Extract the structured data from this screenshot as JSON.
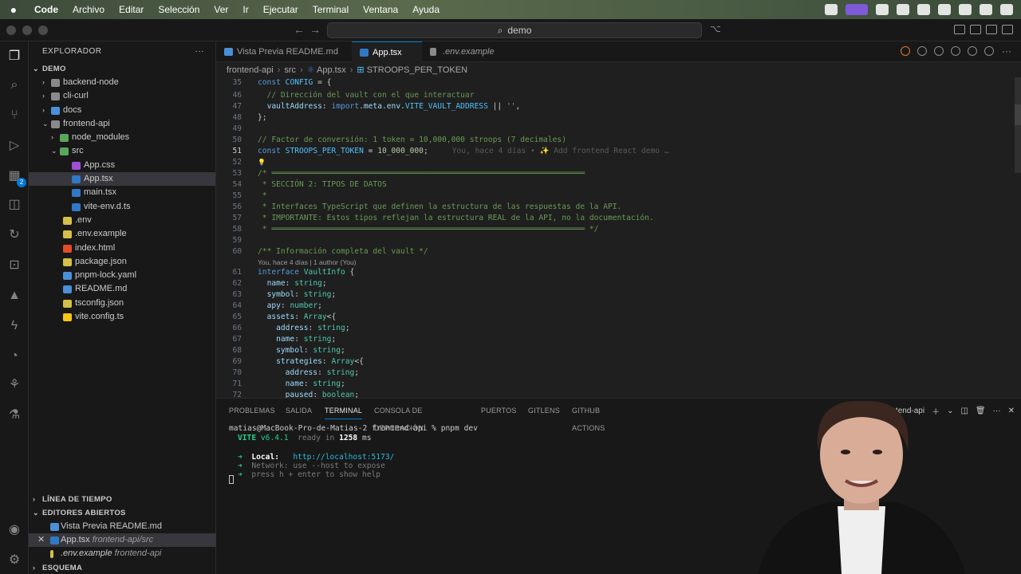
{
  "menubar": {
    "apple": "",
    "items": [
      "Code",
      "Archivo",
      "Editar",
      "Selección",
      "Ver",
      "Ir",
      "Ejecutar",
      "Terminal",
      "Ventana",
      "Ayuda"
    ]
  },
  "titlebar": {
    "search": "demo"
  },
  "explorer": {
    "title": "EXPLORADOR",
    "root": "DEMO",
    "tree": [
      {
        "label": "backend-node",
        "depth": 1,
        "kind": "folder",
        "chev": "›"
      },
      {
        "label": "cli-curl",
        "depth": 1,
        "kind": "folder",
        "chev": "›"
      },
      {
        "label": "docs",
        "depth": 1,
        "kind": "folder-blue",
        "chev": "›"
      },
      {
        "label": "frontend-api",
        "depth": 1,
        "kind": "folder",
        "chev": "⌄"
      },
      {
        "label": "node_modules",
        "depth": 2,
        "kind": "folder-green",
        "chev": "›"
      },
      {
        "label": "src",
        "depth": 2,
        "kind": "folder-green",
        "chev": "⌄"
      },
      {
        "label": "App.css",
        "depth": 3,
        "kind": "css"
      },
      {
        "label": "App.tsx",
        "depth": 3,
        "kind": "tsx",
        "selected": true
      },
      {
        "label": "main.tsx",
        "depth": 3,
        "kind": "tsx"
      },
      {
        "label": "vite-env.d.ts",
        "depth": 3,
        "kind": "ts"
      },
      {
        "label": ".env",
        "depth": 2,
        "kind": "env"
      },
      {
        "label": ".env.example",
        "depth": 2,
        "kind": "env"
      },
      {
        "label": "index.html",
        "depth": 2,
        "kind": "html"
      },
      {
        "label": "package.json",
        "depth": 2,
        "kind": "json"
      },
      {
        "label": "pnpm-lock.yaml",
        "depth": 2,
        "kind": "yaml"
      },
      {
        "label": "README.md",
        "depth": 2,
        "kind": "md"
      },
      {
        "label": "tsconfig.json",
        "depth": 2,
        "kind": "json"
      },
      {
        "label": "vite.config.ts",
        "depth": 2,
        "kind": "vite"
      }
    ],
    "timeline": "LÍNEA DE TIEMPO",
    "open_editors": "EDITORES ABIERTOS",
    "open_items": [
      {
        "label": "Vista Previa README.md",
        "path": ""
      },
      {
        "label": "App.tsx",
        "path": "frontend-api/src"
      },
      {
        "label": ".env.example",
        "path": "frontend-api"
      }
    ],
    "outline": "ESQUEMA"
  },
  "tabs": [
    {
      "label": "Vista Previa README.md",
      "active": false,
      "italic": false
    },
    {
      "label": "App.tsx",
      "active": true,
      "italic": false
    },
    {
      "label": ".env.example",
      "active": false,
      "italic": true
    }
  ],
  "breadcrumb": [
    "frontend-api",
    "src",
    "App.tsx",
    "STROOPS_PER_TOKEN"
  ],
  "code": {
    "blame_51": "You, hace 4 días • ✨ Add frontend React demo …",
    "lens_60": "You, hace 4 días | 1 author (You)",
    "lines": [
      {
        "n": "35",
        "t": "const CONFIG = {"
      },
      {
        "n": "46",
        "t": "  // Dirección del vault con el que interactuar"
      },
      {
        "n": "47",
        "t": "  vaultAddress: import.meta.env.VITE_VAULT_ADDRESS || '',"
      },
      {
        "n": "48",
        "t": "};"
      },
      {
        "n": "49",
        "t": ""
      },
      {
        "n": "50",
        "t": "// Factor de conversión: 1 token = 10,000,000 stroops (7 decimales)"
      },
      {
        "n": "51",
        "t": "const STROOPS_PER_TOKEN = 10_000_000;"
      },
      {
        "n": "52",
        "t": ""
      },
      {
        "n": "53",
        "t": "/* ════════════════════════════════════════════════════════════════════"
      },
      {
        "n": "54",
        "t": " * SECCIÓN 2: TIPOS DE DATOS"
      },
      {
        "n": "55",
        "t": " *"
      },
      {
        "n": "56",
        "t": " * Interfaces TypeScript que definen la estructura de las respuestas de la API."
      },
      {
        "n": "57",
        "t": " * IMPORTANTE: Estos tipos reflejan la estructura REAL de la API, no la documentación."
      },
      {
        "n": "58",
        "t": " * ════════════════════════════════════════════════════════════════════ */"
      },
      {
        "n": "59",
        "t": ""
      },
      {
        "n": "60",
        "t": "/** Información completa del vault */"
      },
      {
        "n": "61",
        "t": "interface VaultInfo {"
      },
      {
        "n": "62",
        "t": "  name: string;"
      },
      {
        "n": "63",
        "t": "  symbol: string;"
      },
      {
        "n": "64",
        "t": "  apy: number;"
      },
      {
        "n": "65",
        "t": "  assets: Array<{"
      },
      {
        "n": "66",
        "t": "    address: string;"
      },
      {
        "n": "67",
        "t": "    name: string;"
      },
      {
        "n": "68",
        "t": "    symbol: string;"
      },
      {
        "n": "69",
        "t": "    strategies: Array<{"
      },
      {
        "n": "70",
        "t": "      address: string;"
      },
      {
        "n": "71",
        "t": "      name: string;"
      },
      {
        "n": "72",
        "t": "      paused: boolean;"
      }
    ]
  },
  "panel": {
    "tabs": [
      "PROBLEMAS",
      "SALIDA",
      "TERMINAL",
      "CONSOLA DE DEPURACIÓN",
      "PUERTOS",
      "GITLENS",
      "GITHUB ACTIONS"
    ],
    "active_tab": "TERMINAL",
    "terminal_name": "frontend-api",
    "prompt": "matias@MacBook-Pro-de-Matias-2 frontend-api % pnpm dev",
    "vite": "VITE",
    "vite_version": "v6.4.1",
    "ready": "ready in",
    "ready_ms": "1258",
    "ready_unit": "ms",
    "local_label": "Local:",
    "local_url": "http://localhost:5173/",
    "network": "Network: use --host to expose",
    "help": "press h + enter to show help"
  },
  "colors": {
    "accent": "#0078d4",
    "background": "#1f1f1f",
    "sidebar": "#181818"
  }
}
